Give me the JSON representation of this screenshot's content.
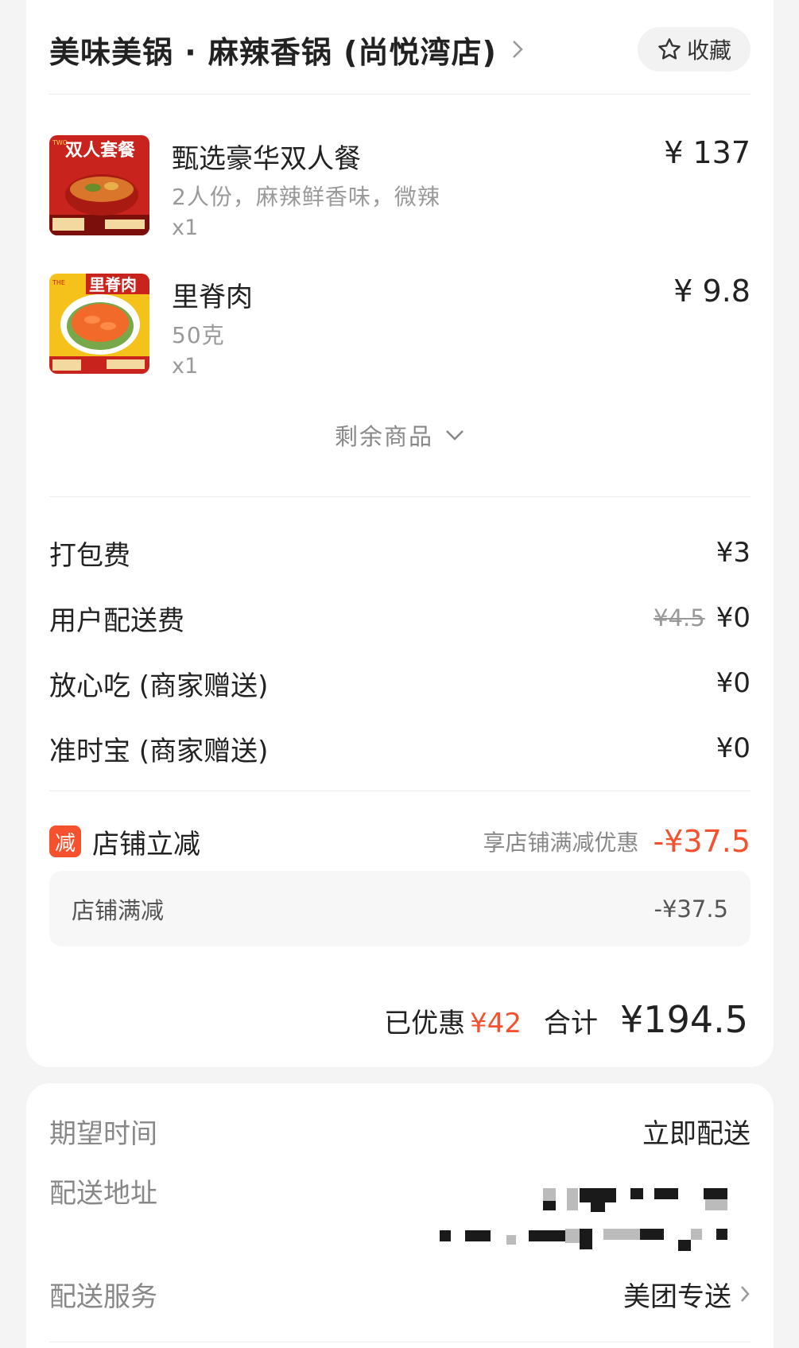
{
  "shop": {
    "name": "美味美锅 · 麻辣香锅 (尚悦湾店)",
    "favorite_label": "收藏"
  },
  "items": [
    {
      "name": "甄选豪华双人餐",
      "spec": "2人份，麻辣鲜香味，微辣",
      "qty": "x1",
      "price": "¥ 137",
      "image_title": "双人套餐"
    },
    {
      "name": "里脊肉",
      "spec": "50克",
      "qty": "x1",
      "price": "¥ 9.8",
      "image_title": "里脊肉"
    }
  ],
  "more_items_label": "剩余商品",
  "fees": [
    {
      "label": "打包费",
      "original": "",
      "value": "¥3"
    },
    {
      "label": "用户配送费",
      "original": "¥4.5",
      "value": "¥0"
    },
    {
      "label": "放心吃 (商家赠送)",
      "original": "",
      "value": "¥0"
    },
    {
      "label": "准时宝 (商家赠送)",
      "original": "",
      "value": "¥0"
    }
  ],
  "discount": {
    "badge": "减",
    "label": "店铺立减",
    "note": "享店铺满减优惠",
    "amount": "-¥37.5",
    "sub_label": "店铺满减",
    "sub_amount": "-¥37.5"
  },
  "summary": {
    "saved_label": "已优惠",
    "saved_amount": "¥42",
    "total_label": "合计",
    "total_amount": "¥194.5"
  },
  "delivery": {
    "time_label": "期望时间",
    "time_value": "立即配送",
    "address_label": "配送地址",
    "service_label": "配送服务",
    "service_value": "美团专送"
  },
  "colors": {
    "accent": "#f5512e",
    "muted": "#999999"
  }
}
